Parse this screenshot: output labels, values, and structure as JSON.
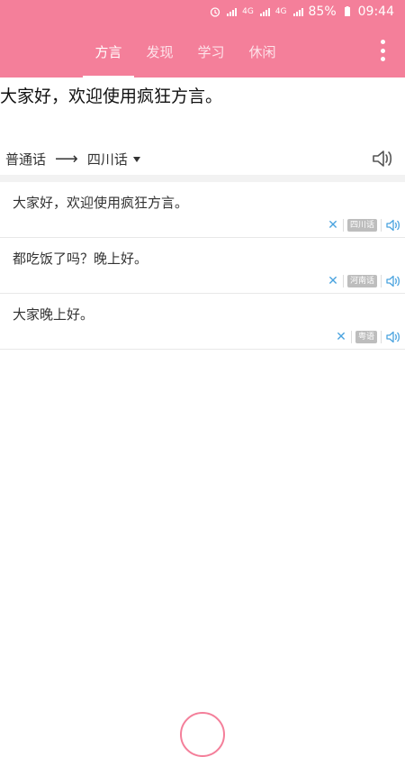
{
  "colors": {
    "brand": "#f47f9a",
    "accent_blue": "#4aa3df"
  },
  "status": {
    "battery": "85%",
    "time": "09:44",
    "network1": "4G",
    "network2": "4G"
  },
  "header": {
    "tabs": [
      {
        "label": "方言",
        "active": true
      },
      {
        "label": "发现",
        "active": false
      },
      {
        "label": "学习",
        "active": false
      },
      {
        "label": "休闲",
        "active": false
      }
    ]
  },
  "input": {
    "text": "大家好，欢迎使用疯狂方言。"
  },
  "lang_bar": {
    "source": "普通话",
    "target": "四川话"
  },
  "history": [
    {
      "text": "大家好，欢迎使用疯狂方言。",
      "dialect": "四川话"
    },
    {
      "text": "都吃饭了吗？晚上好。",
      "dialect": "河南话"
    },
    {
      "text": "大家晚上好。",
      "dialect": "粤语"
    }
  ],
  "icons": {
    "alarm": "alarm-icon",
    "signal": "signal-icon",
    "battery": "battery-icon",
    "menu": "more-vertical-icon",
    "speaker": "speaker-icon",
    "delete": "close-icon",
    "arrow": "long-arrow-right-icon",
    "caret": "caret-down-icon"
  }
}
